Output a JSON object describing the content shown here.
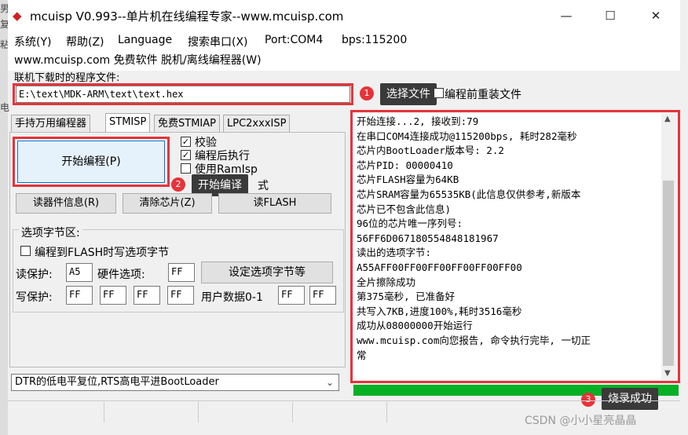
{
  "window": {
    "title": "mcuisp V0.993--单片机在线编程专家--www.mcuisp.com",
    "minimize": "—",
    "maximize": "☐",
    "close": "✕"
  },
  "left_edge": [
    "男",
    "复",
    "粘",
    "电"
  ],
  "menu": {
    "items": [
      "系统(Y)",
      "帮助(Z)",
      "Language",
      "搜索串口(X)",
      "Port:COM4",
      "bps:115200"
    ],
    "line2": "www.mcuisp.com 免费软件 脱机/离线编程器(W)"
  },
  "file": {
    "label": "联机下载时的程序文件:",
    "path": "E:\\text\\MDK-ARM\\text\\text.hex",
    "select_button": "...",
    "reload_label": "编程前重装文件"
  },
  "annotations": [
    {
      "num": "1",
      "text": "选择文件"
    },
    {
      "num": "2",
      "text": "开始编译"
    },
    {
      "num": "3",
      "text": "烧录成功"
    }
  ],
  "tabs": [
    "手持万用编程器",
    "STMISP",
    "免费STMIAP",
    "LPC2xxxISP"
  ],
  "stmisp": {
    "start_button": "开始编程(P)",
    "checks": [
      {
        "label": "校验",
        "checked": true
      },
      {
        "label": "编程后执行",
        "checked": true
      },
      {
        "label": "使用RamIsp",
        "checked": false
      }
    ],
    "hidden_check_tail": "式",
    "read_info": "读器件信息(R)",
    "erase_chip": "清除芯片(Z)",
    "read_flash": "读FLASH",
    "option_group": "选项字节区:",
    "option_write_label": "编程到FLASH时写选项字节",
    "read_protect_label": "读保护:",
    "read_protect_value": "A5",
    "hw_option_label": "硬件选项:",
    "hw_option_value": "FF",
    "set_option_button": "设定选项字节等",
    "write_protect_label": "写保护:",
    "write_protect_values": [
      "FF",
      "FF",
      "FF",
      "FF"
    ],
    "user_data_label": "用户数据0-1",
    "user_data_values": [
      "FF",
      "FF"
    ]
  },
  "boot_mode": "DTR的低电平复位,RTS高电平进BootLoader",
  "log": [
    "开始连接...2, 接收到:79",
    "在串口COM4连接成功@115200bps, 耗时282毫秒",
    "芯片内BootLoader版本号: 2.2",
    "芯片PID: 00000410",
    "芯片FLASH容量为64KB",
    "芯片SRAM容量为65535KB(此信息仅供参考,新版本",
    "芯片已不包含此信息)",
    "96位的芯片唯一序列号:",
    "56FF6D067180554848181967",
    "读出的选项字节:",
    "A55AFF00FF00FF00FF00FF00FF00",
    "全片擦除成功",
    "第375毫秒, 已准备好",
    "共写入7KB,进度100%,耗时3516毫秒",
    "成功从08000000开始运行",
    "www.mcuisp.com向您报告, 命令执行完毕, 一切正",
    "常"
  ],
  "progress": 1.0,
  "watermark": "CSDN @小小星亮晶晶",
  "colors": {
    "accent_red": "#e6333a",
    "progress_green": "#06b025"
  }
}
